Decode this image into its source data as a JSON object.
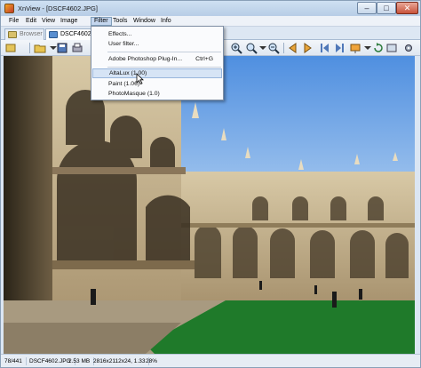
{
  "window": {
    "title": "XnView - [DSCF4602.JPG]"
  },
  "menubar": {
    "items": [
      {
        "label": "File"
      },
      {
        "label": "Edit"
      },
      {
        "label": "View"
      },
      {
        "label": "Image"
      },
      {
        "label": "Filter"
      },
      {
        "label": "Tools"
      },
      {
        "label": "Window"
      },
      {
        "label": "Info"
      }
    ]
  },
  "tabs": [
    {
      "label": "Browser"
    },
    {
      "label": "DSCF4602.JPG"
    }
  ],
  "filter_menu": {
    "items": [
      {
        "label": "Effects..."
      },
      {
        "label": "User filter..."
      },
      {
        "label": "Adobe Photoshop Plug-In...",
        "shortcut": "Ctrl+G"
      },
      {
        "label": "AltaLux (1.00)"
      },
      {
        "label": "Paint (1.06)"
      },
      {
        "label": "PhotoMasque (1.0)"
      }
    ]
  },
  "statusbar": {
    "index": "78/441",
    "filename": "DSCF4602.JPG",
    "filesize": "2.53 MB",
    "dimensions": "2816x2112x24, 1.33",
    "zoom": "28%"
  },
  "colors": {
    "accent": "#c4d6ee",
    "sky": "#6fa6e6",
    "stone": "#c9b894",
    "lawn": "#1f7a2a"
  }
}
